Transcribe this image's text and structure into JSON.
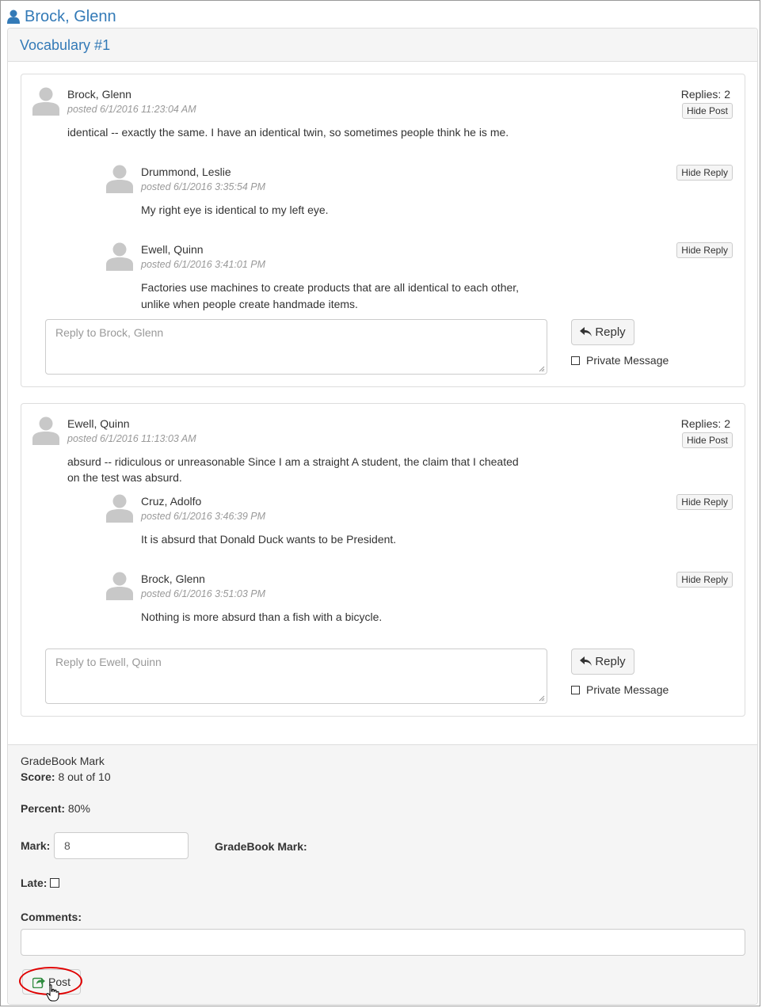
{
  "header": {
    "student_name": "Brock, Glenn",
    "icon": "user-icon",
    "accent": "#337ab7"
  },
  "panel": {
    "title": "Vocabulary #1"
  },
  "threads": [
    {
      "author": "Brock, Glenn",
      "posted": "posted 6/1/2016 11:23:04 AM",
      "replies_count": "Replies: 2",
      "hide_post_label": "Hide Post",
      "text": "identical -- exactly the same. I have an identical twin, so sometimes people think he is me.",
      "replies": [
        {
          "author": "Drummond, Leslie",
          "posted": "posted 6/1/2016 3:35:54 PM",
          "text": "My right eye is identical to my left eye.",
          "hide_label": "Hide Reply"
        },
        {
          "author": "Ewell, Quinn",
          "posted": "posted 6/1/2016 3:41:01 PM",
          "text_line1": "Factories use machines to create products that are all identical to each other,",
          "text_line2": "unlike when people create handmade items.",
          "hide_label": "Hide Reply"
        }
      ],
      "reply_placeholder": "Reply to Brock, Glenn",
      "reply_button": "Reply",
      "private_message_label": "Private Message"
    },
    {
      "author": "Ewell, Quinn",
      "posted": "posted 6/1/2016 11:13:03 AM",
      "replies_count": "Replies: 2",
      "hide_post_label": "Hide Post",
      "text_line1": "absurd -- ridiculous or unreasonable Since I am a straight A student, the claim that I cheated",
      "text_line2": "on the test was absurd.",
      "replies": [
        {
          "author": "Cruz, Adolfo",
          "posted": "posted 6/1/2016 3:46:39 PM",
          "text": "It is absurd that Donald Duck wants to be President.",
          "hide_label": "Hide Reply"
        },
        {
          "author": "Brock, Glenn",
          "posted": "posted 6/1/2016 3:51:03 PM",
          "text": "Nothing is more absurd than a fish with a bicycle.",
          "hide_label": "Hide Reply"
        }
      ],
      "reply_placeholder": "Reply to Ewell, Quinn",
      "reply_button": "Reply",
      "private_message_label": "Private Message"
    }
  ],
  "gradebook": {
    "heading": "GradeBook Mark",
    "score_label": "Score:",
    "score_value": "8 out of 10",
    "percent_label": "Percent:",
    "percent_value": "80%",
    "mark_label": "Mark:",
    "mark_value": "8",
    "gradebook_mark_label": "GradeBook Mark:",
    "late_label": "Late:",
    "late_checked": false,
    "comments_label": "Comments:",
    "comments_value": "",
    "post_button": "Post",
    "highlight_color": "#e00000"
  }
}
